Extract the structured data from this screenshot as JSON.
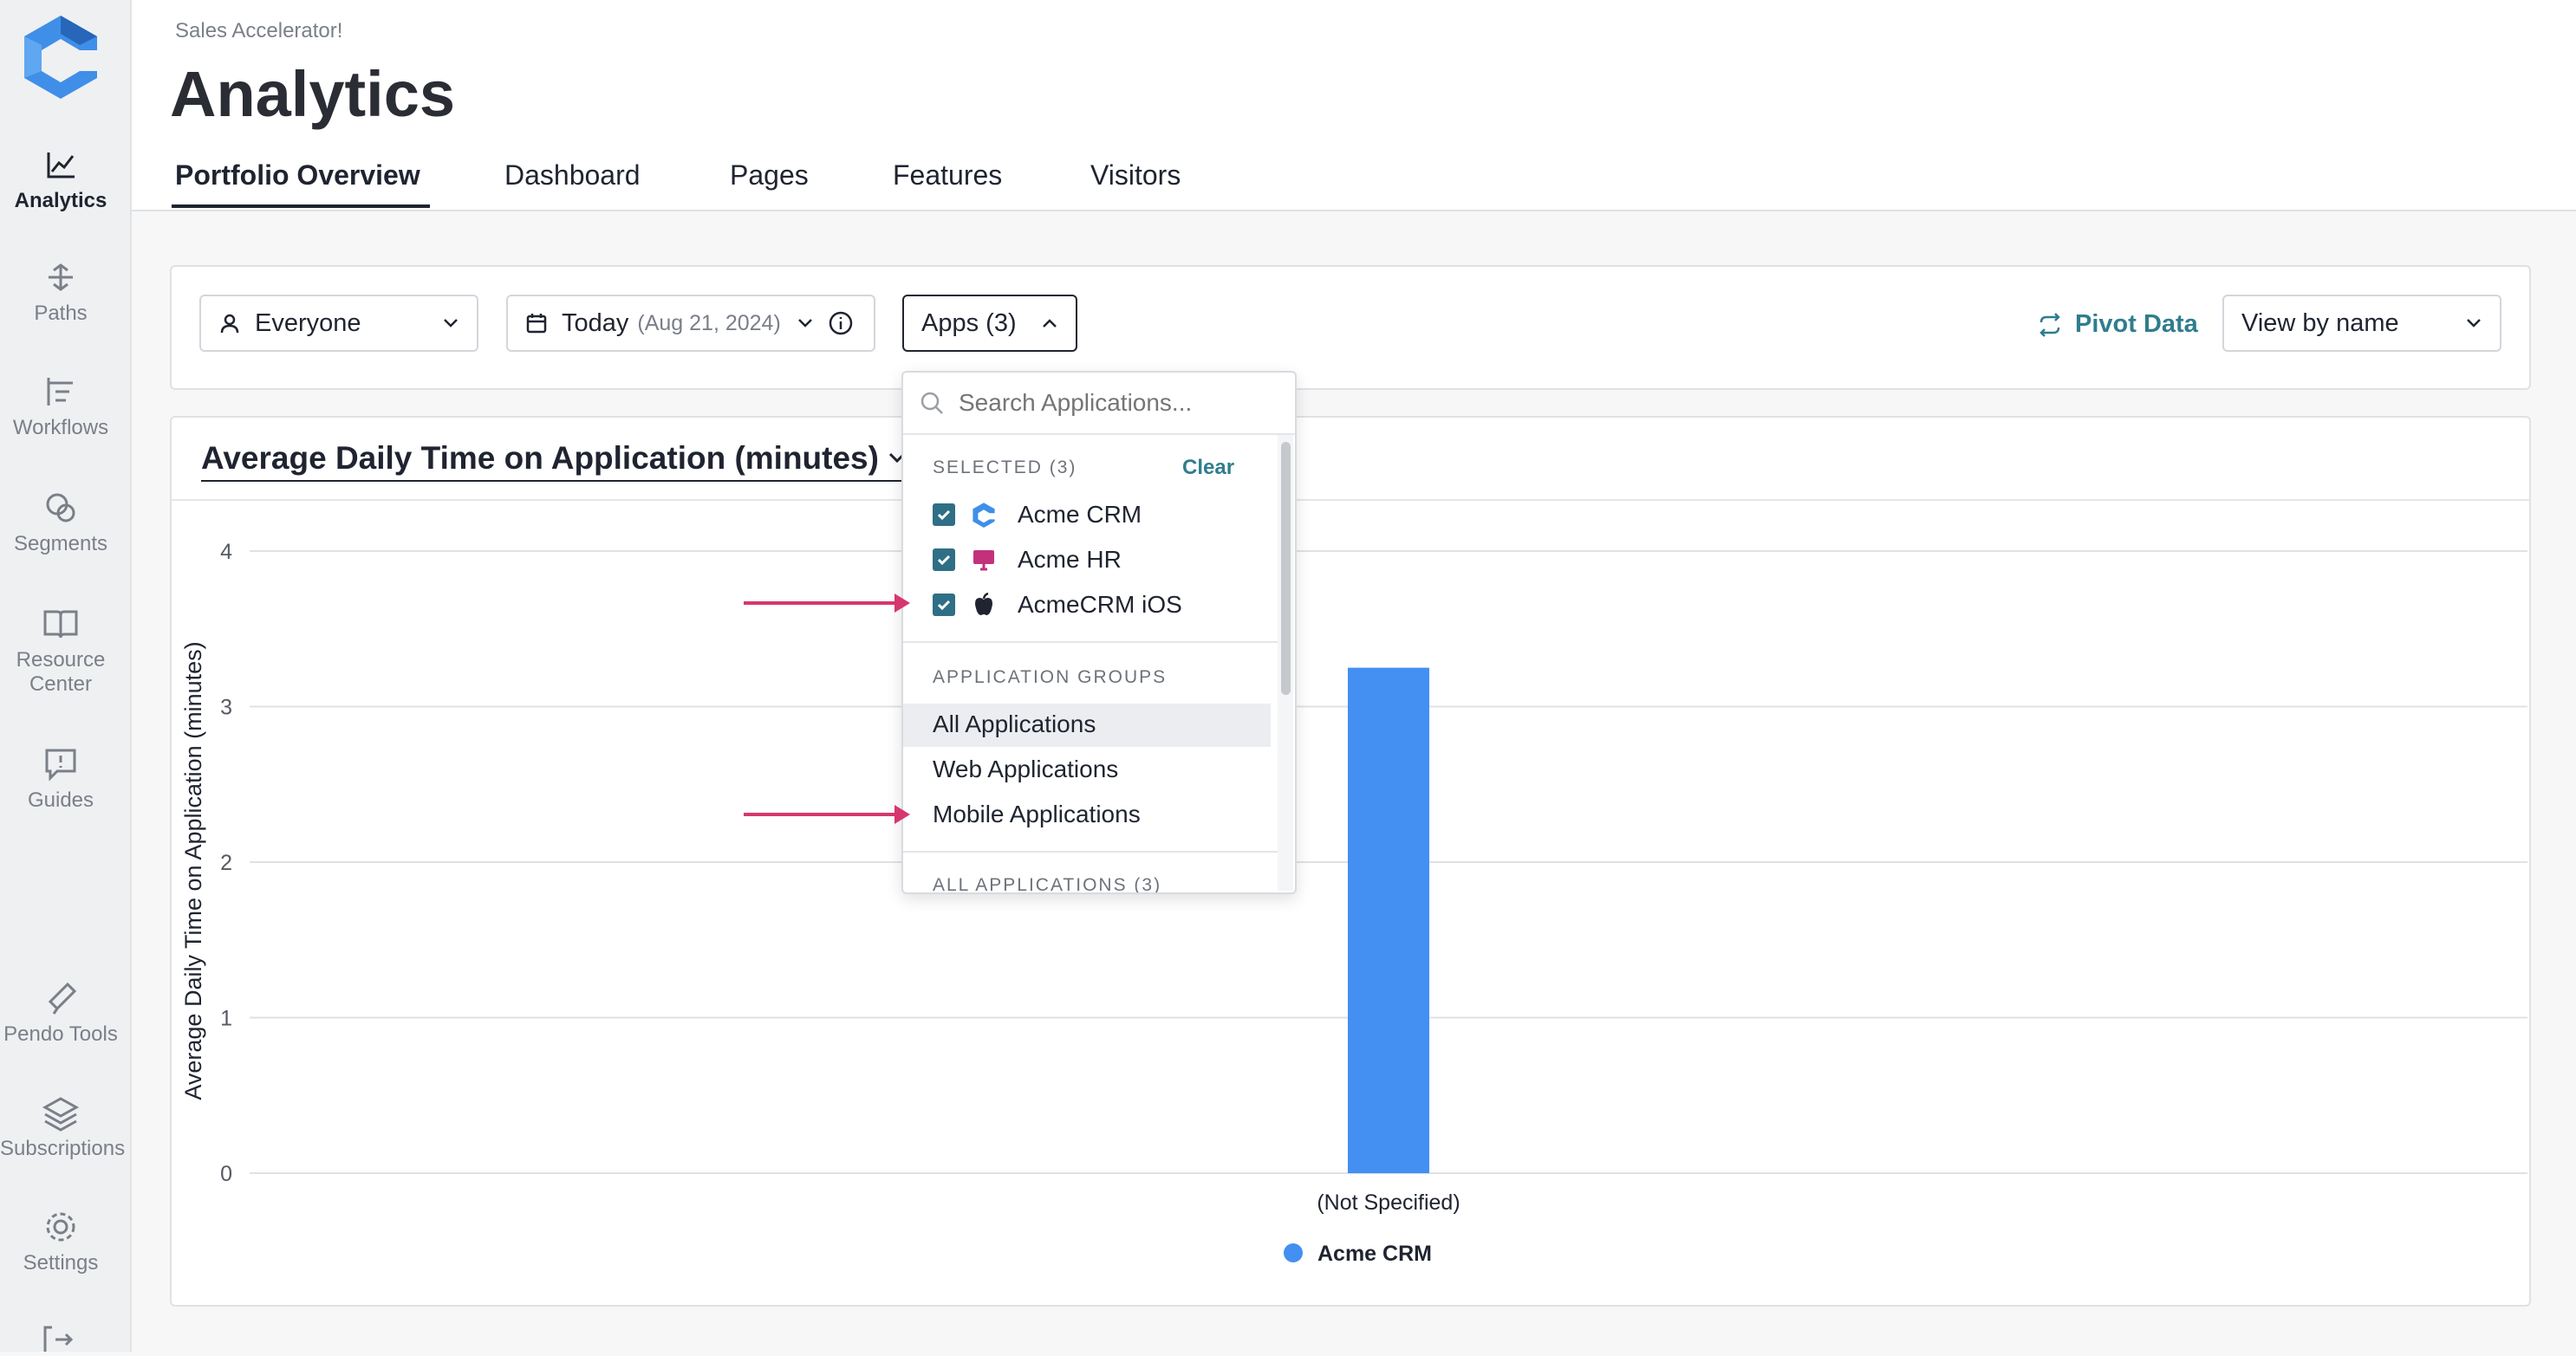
{
  "sidebar": {
    "items": [
      {
        "label": "Analytics",
        "icon": "analytics-icon"
      },
      {
        "label": "Paths",
        "icon": "paths-icon"
      },
      {
        "label": "Workflows",
        "icon": "workflows-icon"
      },
      {
        "label": "Segments",
        "icon": "segments-icon"
      },
      {
        "label": "Resource Center",
        "icon": "book-icon"
      },
      {
        "label": "Guides",
        "icon": "guides-icon"
      },
      {
        "label": "Pendo Tools",
        "icon": "pendo-tools-icon"
      },
      {
        "label": "Subscriptions",
        "icon": "layers-icon"
      },
      {
        "label": "Settings",
        "icon": "gear-icon"
      }
    ]
  },
  "header": {
    "breadcrumb": "Sales Accelerator!",
    "title": "Analytics",
    "tabs": [
      "Portfolio Overview",
      "Dashboard",
      "Pages",
      "Features",
      "Visitors"
    ]
  },
  "filters": {
    "segment": "Everyone",
    "date_label": "Today",
    "date_value": "(Aug 21, 2024)",
    "apps": "Apps (3)",
    "pivot": "Pivot Data",
    "view_by": "View by name"
  },
  "dropdown": {
    "search_placeholder": "Search Applications...",
    "selected_label": "SELECTED (3)",
    "clear_label": "Clear",
    "selected": [
      "Acme CRM",
      "Acme HR",
      "AcmeCRM iOS"
    ],
    "groups_label": "APPLICATION GROUPS",
    "groups": [
      "All Applications",
      "Web Applications",
      "Mobile Applications"
    ],
    "all_apps_label": "ALL APPLICATIONS (3)"
  },
  "chart_title": "Average Daily Time on Application (minutes)",
  "chart_data": {
    "type": "bar",
    "title": "Average Daily Time on Application (minutes)",
    "ylabel": "Average Daily Time on Application (minutes)",
    "xlabel": "",
    "categories": [
      "(Not Specified)"
    ],
    "yticks": [
      "0",
      "1",
      "2",
      "3",
      "4"
    ],
    "ylim": [
      0,
      4
    ],
    "series": [
      {
        "name": "Acme CRM",
        "values": [
          3.25
        ],
        "color": "#4390f2"
      }
    ],
    "legend_position": "bottom",
    "grid": true
  },
  "colors": {
    "accent": "#2f7d8d",
    "bar": "#4390f2",
    "arrow": "#d6376f"
  }
}
